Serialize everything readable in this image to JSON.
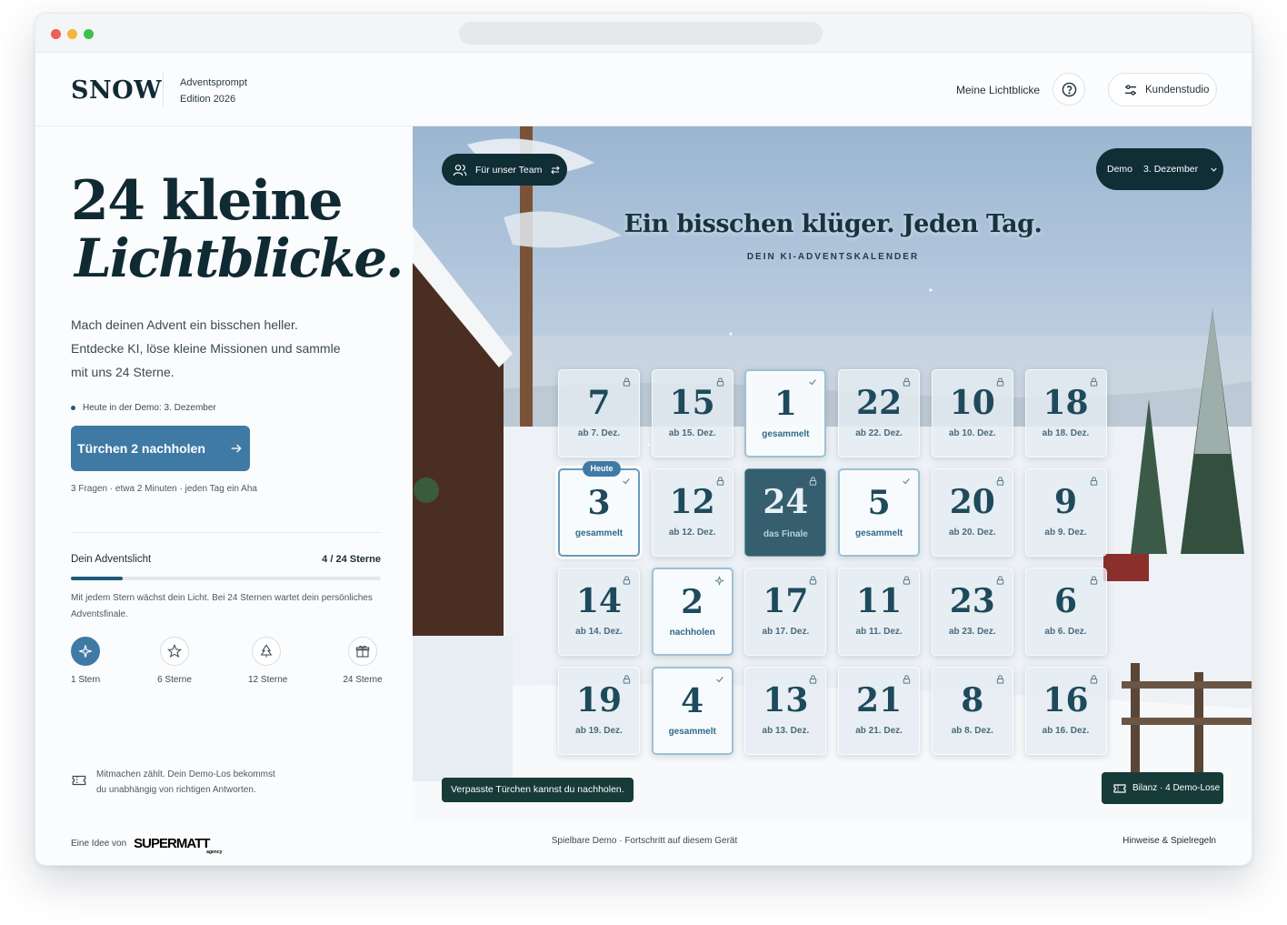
{
  "header": {
    "logo": "SNOW",
    "edition_line1": "Adventsprompt",
    "edition_line2": "Edition 2026",
    "nav_link": "Meine Lichtblicke",
    "help_icon": "help-circle-icon",
    "studio_label": "Kundenstudio",
    "studio_icon": "sliders-icon"
  },
  "left": {
    "hero_line1": "24 kleine",
    "hero_line2": "Lichtblicke.",
    "intro": "Mach deinen Advent ein bisschen heller. Entdecke KI, löse kleine Missionen und sammle mit uns 24 Sterne.",
    "today_note": "Heute in der Demo: 3. Dezember",
    "cta_label": "Türchen 2 nachholen",
    "cta_icon": "arrow-right-icon",
    "cta_sub": "3 Fragen · etwa 2 Minuten · jeden Tag ein Aha",
    "light_title": "Dein Adventslicht",
    "light_count": "4 / 24 Sterne",
    "progress_fraction": 0.1667,
    "light_desc": "Mit jedem Stern wächst dein Licht. Bei 24 Sternen wartet dein persönliches Adventsfinale.",
    "milestones": [
      {
        "label": "1 Stern",
        "icon": "sparkle-icon",
        "active": true
      },
      {
        "label": "6 Sterne",
        "icon": "star-icon",
        "active": false
      },
      {
        "label": "12 Sterne",
        "icon": "tree-icon",
        "active": false
      },
      {
        "label": "24 Sterne",
        "icon": "gift-icon",
        "active": false
      }
    ],
    "demo_note": "Mitmachen zählt. Dein Demo-Los bekommst du unabhängig von richtigen Antworten.",
    "demo_icon": "ticket-icon"
  },
  "calendar": {
    "team_pill": "Für unser Team",
    "date_pill_label": "Demo",
    "date_pill_value": "3. Dezember",
    "title": "Ein bisschen klüger. Jeden Tag.",
    "subtitle": "DEIN KI-ADVENTSKALENDER",
    "today_badge": "Heute",
    "doors": [
      {
        "num": "7",
        "label": "ab 7. Dez.",
        "state": "locked"
      },
      {
        "num": "15",
        "label": "ab 15. Dez.",
        "state": "locked"
      },
      {
        "num": "1",
        "label": "gesammelt",
        "state": "open"
      },
      {
        "num": "22",
        "label": "ab 22. Dez.",
        "state": "locked"
      },
      {
        "num": "10",
        "label": "ab 10. Dez.",
        "state": "locked"
      },
      {
        "num": "18",
        "label": "ab 18. Dez.",
        "state": "locked"
      },
      {
        "num": "3",
        "label": "gesammelt",
        "state": "today"
      },
      {
        "num": "12",
        "label": "ab 12. Dez.",
        "state": "locked"
      },
      {
        "num": "24",
        "label": "das Finale",
        "state": "finale"
      },
      {
        "num": "5",
        "label": "gesammelt",
        "state": "open"
      },
      {
        "num": "20",
        "label": "ab 20. Dez.",
        "state": "locked"
      },
      {
        "num": "9",
        "label": "ab 9. Dez.",
        "state": "locked"
      },
      {
        "num": "14",
        "label": "ab 14. Dez.",
        "state": "locked"
      },
      {
        "num": "2",
        "label": "nachholen",
        "state": "catchup"
      },
      {
        "num": "17",
        "label": "ab 17. Dez.",
        "state": "locked"
      },
      {
        "num": "11",
        "label": "ab 11. Dez.",
        "state": "locked"
      },
      {
        "num": "23",
        "label": "ab 23. Dez.",
        "state": "locked"
      },
      {
        "num": "6",
        "label": "ab 6. Dez.",
        "state": "locked"
      },
      {
        "num": "19",
        "label": "ab 19. Dez.",
        "state": "locked"
      },
      {
        "num": "4",
        "label": "gesammelt",
        "state": "open"
      },
      {
        "num": "13",
        "label": "ab 13. Dez.",
        "state": "locked"
      },
      {
        "num": "21",
        "label": "ab 21. Dez.",
        "state": "locked"
      },
      {
        "num": "8",
        "label": "ab 8. Dez.",
        "state": "locked"
      },
      {
        "num": "16",
        "label": "ab 16. Dez.",
        "state": "locked"
      }
    ],
    "catchup_note": "Verpasste Türchen kannst du nachholen.",
    "bilanz": "Bilanz · 4 Demo-Lose"
  },
  "footer": {
    "idea_prefix": "Eine Idee von",
    "brand": "SUPERMATT",
    "brand_sub": "agency",
    "center": "Spielbare Demo · Fortschritt auf diesem Gerät",
    "right": "Hinweise & Spielregeln"
  },
  "colors": {
    "accent": "#3f7aa5",
    "dark": "#0f2e35",
    "text": "#102a33"
  }
}
